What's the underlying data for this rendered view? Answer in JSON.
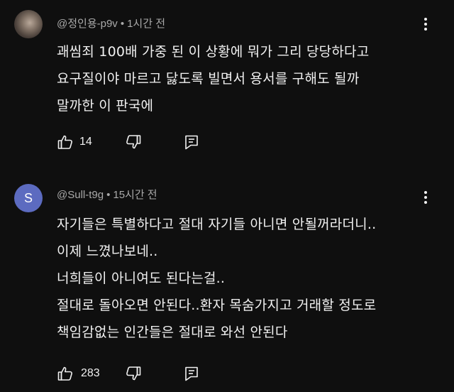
{
  "comments": [
    {
      "author": "@정인용-p9v",
      "separator": "•",
      "time": "1시간 전",
      "lines": [
        "괘씸죄 100배 가중 된 이 상황에 뭐가 그리 당당하다고",
        "요구질이야 마르고 닳도록 빌면서 용서를 구해도 될까",
        "말까한 이 판국에"
      ],
      "likes": "14",
      "avatar_icon": "user-photo-avatar"
    },
    {
      "author": "@Sull-t9g",
      "separator": "•",
      "time": "15시간 전",
      "avatar_letter": "S",
      "avatar_color": "#5c6bc0",
      "lines": [
        "자기들은 특별하다고 절대 자기들 아니면 안될꺼라더니..",
        "이제 느꼈나보네..",
        "너희들이 아니여도 된다는걸..",
        "절대로 돌아오면 안된다..환자 목숨가지고 거래할 정도로",
        "책임감없는 인간들은 절대로 와선 안된다"
      ],
      "likes": "283"
    }
  ],
  "icons": {
    "like": "thumbs-up-icon",
    "dislike": "thumbs-down-icon",
    "reply": "reply-comment-icon",
    "more": "more-vertical-icon"
  },
  "colors": {
    "background": "#0f0f0f",
    "text": "#f1f1f1",
    "meta": "#aaaaaa"
  }
}
